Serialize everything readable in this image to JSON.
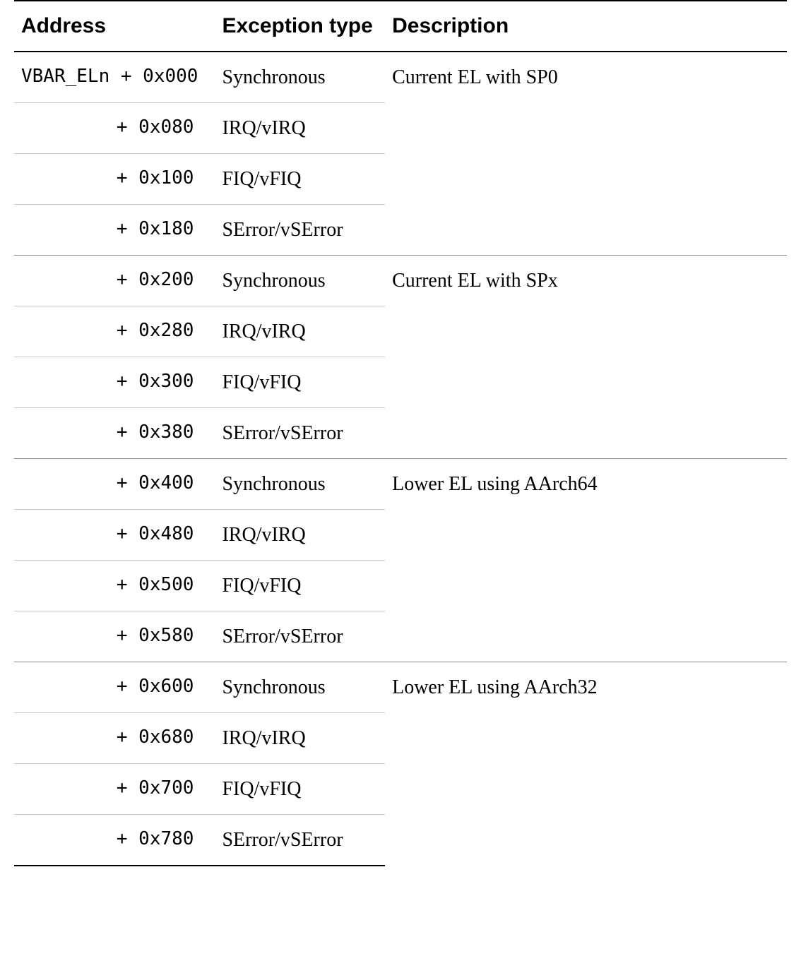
{
  "headers": {
    "address": "Address",
    "exception_type": "Exception type",
    "description": "Description"
  },
  "address_prefix_label": "VBAR_ELn",
  "groups": [
    {
      "description": "Current EL with SP0",
      "rows": [
        {
          "offset": "+ 0x000",
          "prefix": true,
          "type": "Synchronous"
        },
        {
          "offset": "+ 0x080",
          "prefix": false,
          "type": "IRQ/vIRQ"
        },
        {
          "offset": "+ 0x100",
          "prefix": false,
          "type": "FIQ/vFIQ"
        },
        {
          "offset": "+ 0x180",
          "prefix": false,
          "type": "SError/vSError"
        }
      ]
    },
    {
      "description": "Current EL with SPx",
      "rows": [
        {
          "offset": "+ 0x200",
          "prefix": false,
          "type": "Synchronous"
        },
        {
          "offset": "+ 0x280",
          "prefix": false,
          "type": "IRQ/vIRQ"
        },
        {
          "offset": "+ 0x300",
          "prefix": false,
          "type": "FIQ/vFIQ"
        },
        {
          "offset": "+ 0x380",
          "prefix": false,
          "type": "SError/vSError"
        }
      ]
    },
    {
      "description": "Lower EL using AArch64",
      "rows": [
        {
          "offset": "+ 0x400",
          "prefix": false,
          "type": "Synchronous"
        },
        {
          "offset": "+ 0x480",
          "prefix": false,
          "type": "IRQ/vIRQ"
        },
        {
          "offset": "+ 0x500",
          "prefix": false,
          "type": "FIQ/vFIQ"
        },
        {
          "offset": "+ 0x580",
          "prefix": false,
          "type": "SError/vSError"
        }
      ]
    },
    {
      "description": "Lower EL using AArch32",
      "rows": [
        {
          "offset": "+ 0x600",
          "prefix": false,
          "type": "Synchronous"
        },
        {
          "offset": "+ 0x680",
          "prefix": false,
          "type": "IRQ/vIRQ"
        },
        {
          "offset": "+ 0x700",
          "prefix": false,
          "type": "FIQ/vFIQ"
        },
        {
          "offset": "+ 0x780",
          "prefix": false,
          "type": "SError/vSError"
        }
      ]
    }
  ]
}
